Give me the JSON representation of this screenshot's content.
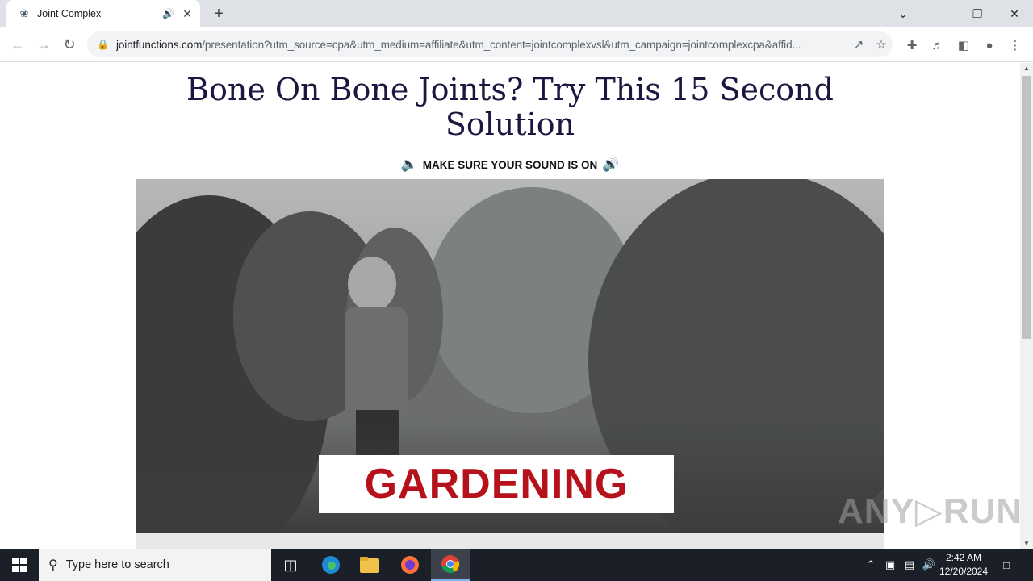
{
  "browser": {
    "tab_title": "Joint Complex",
    "url_host": "jointfunctions.com",
    "url_path": "/presentation?utm_source=cpa&utm_medium=affiliate&utm_content=jointcomplexvsl&utm_campaign=jointcomplexcpa&affid..."
  },
  "page": {
    "headline": "Bone On Bone Joints? Try This 15 Second Solution",
    "sound_notice": "MAKE SURE YOUR SOUND IS ON",
    "video_caption": "GARDENING",
    "watermark": "ANY▷RUN"
  },
  "taskbar": {
    "search_placeholder": "Type here to search",
    "time": "2:42 AM",
    "date": "12/20/2024"
  }
}
